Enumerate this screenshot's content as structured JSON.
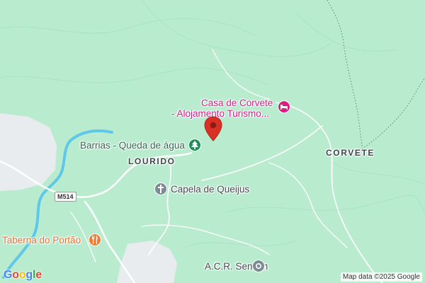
{
  "map": {
    "pois": [
      {
        "name": "Casa de Corvete",
        "name_line2": "- Alojamento Turismo...",
        "category": "lodging",
        "icon": "bed-icon",
        "color": "#e01c84"
      },
      {
        "name": "Barrias - Queda de água",
        "category": "nature",
        "icon": "tree-icon",
        "color": "#1e8e5a"
      },
      {
        "name": "Capela de Queijus",
        "category": "church",
        "icon": "cross-icon",
        "color": "#7c8b93"
      },
      {
        "name": "Taberna do Portão",
        "category": "restaurant",
        "icon": "fork-knife-icon",
        "color": "#f07d31"
      },
      {
        "name": "A.C.R. Sendim",
        "category": "place",
        "icon": "circle-dot-icon",
        "color": "#7c8b93"
      }
    ],
    "places": [
      {
        "name": "CORVETE"
      },
      {
        "name": "LOURIDO"
      }
    ],
    "road_shield": "M514",
    "marker": {
      "icon": "map-pin-icon",
      "color": "#d93025"
    },
    "colors": {
      "land": "#b9eccf",
      "urban": "#e9ecef",
      "water": "#5fc8e9",
      "road": "#ffffff"
    }
  },
  "branding": {
    "logo": "Google"
  },
  "attribution": "Map data ©2025 Google"
}
